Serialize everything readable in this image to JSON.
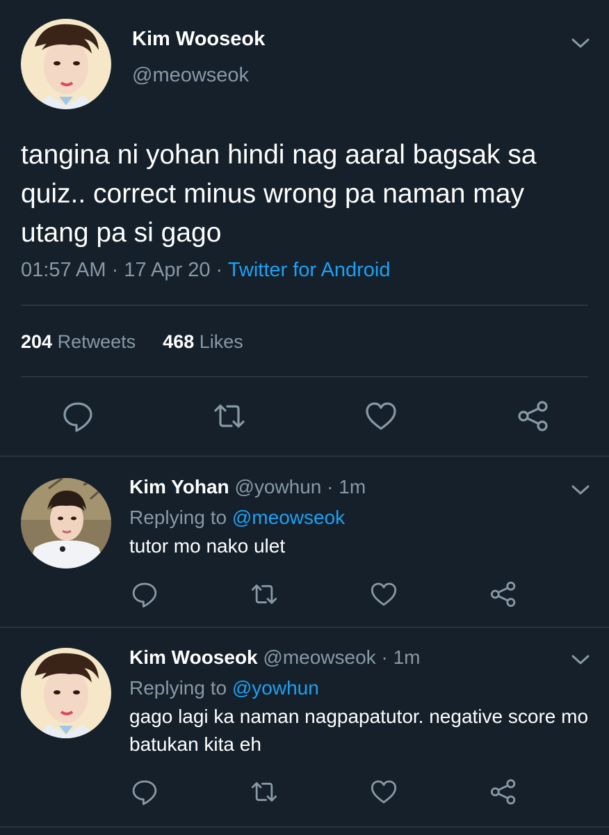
{
  "main_tweet": {
    "display_name": "Kim Wooseok",
    "handle": "@meowseok",
    "text": "tangina ni yohan hindi nag aaral bagsak sa quiz.. correct minus wrong pa naman may utang pa si gago",
    "time": "01:57 AM",
    "date": "17 Apr 20",
    "separator": "·",
    "source": "Twitter for Android",
    "retweets_count": "204",
    "retweets_label": "Retweets",
    "likes_count": "468",
    "likes_label": "Likes"
  },
  "replies": [
    {
      "display_name": "Kim Yohan",
      "handle": "@yowhun",
      "separator": "·",
      "age": "1m",
      "replying_label": "Replying to",
      "replying_to": "@meowseok",
      "text": "tutor mo nako ulet"
    },
    {
      "display_name": "Kim Wooseok",
      "handle": "@meowseok",
      "separator": "·",
      "age": "1m",
      "replying_label": "Replying to",
      "replying_to": "@yowhun",
      "text": "gago lagi ka naman nagpapatutor. negative score mo batukan kita eh"
    }
  ],
  "icons": {
    "reply": "reply-icon",
    "retweet": "retweet-icon",
    "like": "heart-icon",
    "share": "share-icon",
    "menu": "chevron-down-icon"
  },
  "colors": {
    "background": "#15202b",
    "text": "#ffffff",
    "muted": "#8899a6",
    "link": "#1da1f2",
    "divider": "#38444d"
  }
}
